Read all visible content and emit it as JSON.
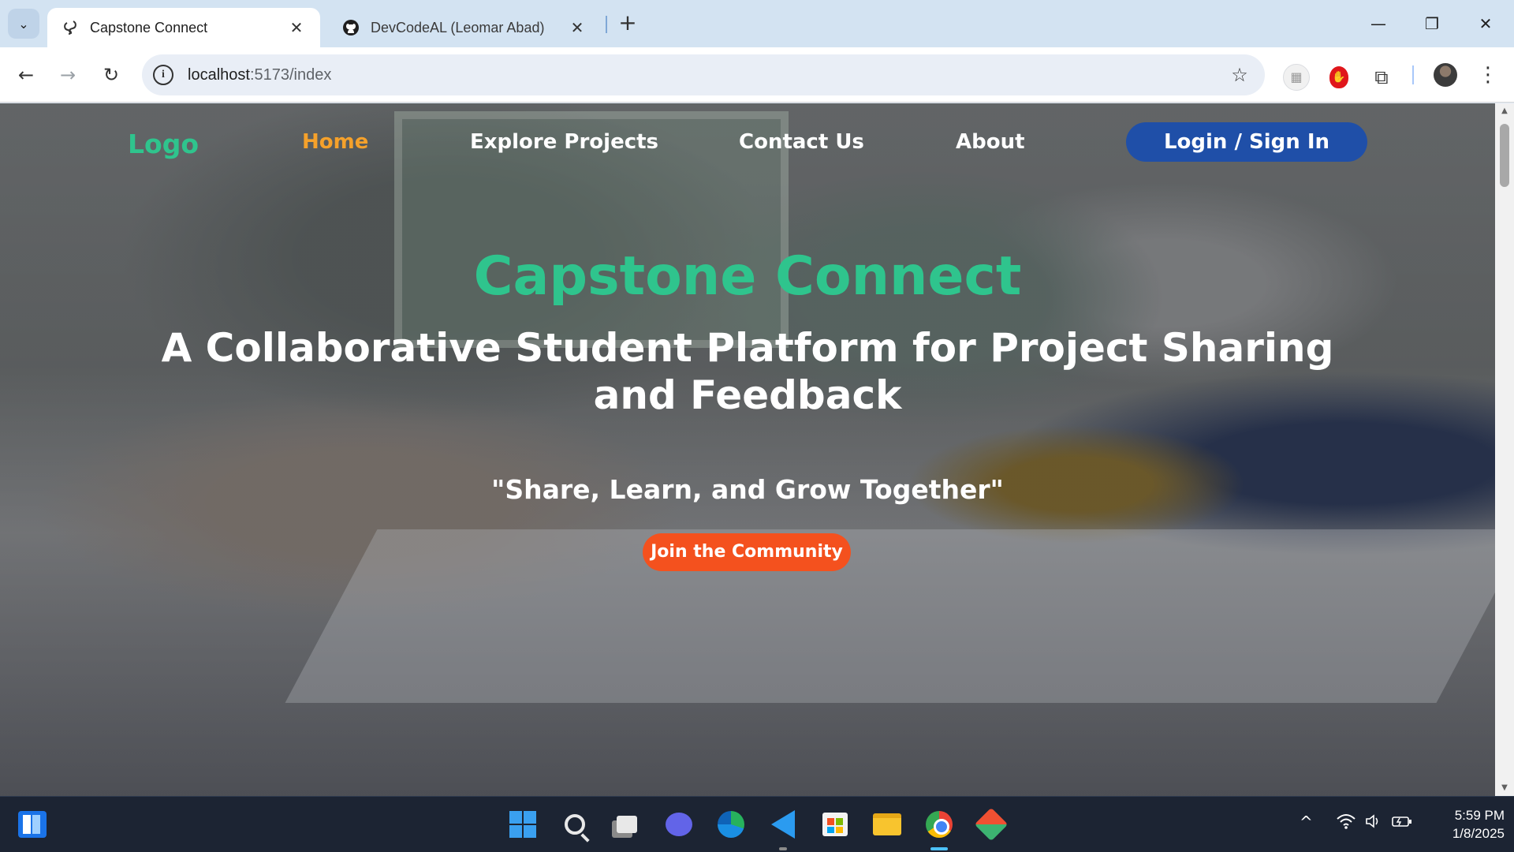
{
  "browser": {
    "tabs": [
      {
        "title": "Capstone Connect",
        "icon": "capstone-favicon",
        "active": true
      },
      {
        "title": "DevCodeAL (Leomar Abad)",
        "icon": "github-icon",
        "active": false
      }
    ],
    "tab_close_glyph": "✕",
    "new_tab_glyph": "+",
    "window_controls": {
      "minimize": "—",
      "restore": "❐",
      "close": "✕"
    },
    "address": {
      "host": "localhost",
      "path": ":5173/index"
    },
    "nav_glyphs": {
      "back": "←",
      "forward": "→",
      "reload": "↻",
      "star": "☆",
      "menu": "⋮"
    }
  },
  "site": {
    "nav": {
      "logo": "Logo",
      "links": [
        "Home",
        "Explore Projects",
        "Contact Us",
        "About"
      ],
      "active_link": "Home",
      "login": "Login / Sign In"
    },
    "hero": {
      "title": "Capstone Connect",
      "subtitle": "A Collaborative Student Platform for Project Sharing and Feedback",
      "quote": "\"Share, Learn, and Grow Together\"",
      "cta": "Join the Community"
    },
    "colors": {
      "brand_green": "#2fc48d",
      "active_orange": "#f5a12b",
      "login_blue": "#1f4fa8",
      "cta_orange": "#f4511e"
    }
  },
  "taskbar": {
    "apps": [
      "widgets-icon",
      "windows-start-icon",
      "search-icon",
      "task-view-icon",
      "teams-icon",
      "edge-icon",
      "vscode-icon",
      "store-icon",
      "file-explorer-icon",
      "chrome-icon",
      "gitkraken-icon"
    ],
    "tray": {
      "chevron": "^",
      "wifi": "wifi-icon",
      "volume": "volume-icon",
      "battery": "battery-icon"
    },
    "clock": {
      "time": "5:59 PM",
      "date": "1/8/2025"
    }
  }
}
